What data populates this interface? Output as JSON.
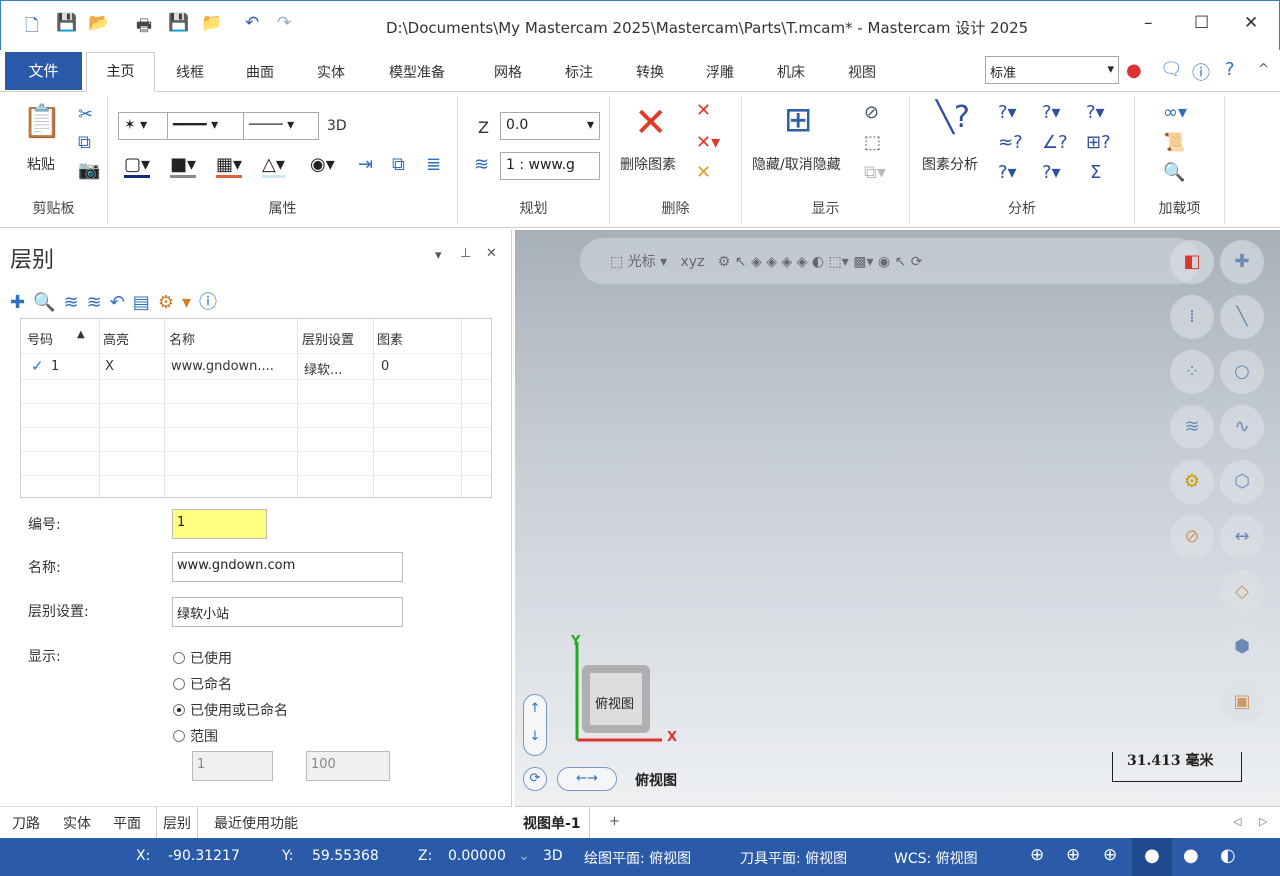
{
  "window": {
    "title": "D:\\Documents\\My Mastercam 2025\\Mastercam\\Parts\\T.mcam* - Mastercam 设计 2025",
    "minimize": "–",
    "maximize": "☐",
    "close": "✕"
  },
  "ribbon_tabs": [
    "文件",
    "主页",
    "线框",
    "曲面",
    "实体",
    "模型准备",
    "网格",
    "标注",
    "转换",
    "浮雕",
    "机床",
    "视图"
  ],
  "style_select": "标准",
  "groups": {
    "clipboard": "剪贴板",
    "paste": "粘贴",
    "attributes": "属性",
    "three_d": "3D",
    "planning": "规划",
    "z_label": "Z",
    "z_value": "0.0",
    "level_value": "1 : www.g",
    "delete": "删除",
    "delete_entity": "删除图素",
    "display": "显示",
    "hide_unhide": "隐藏/取消隐藏",
    "analyze": "分析",
    "entity_analysis": "图素分析",
    "addins": "加载项"
  },
  "panel": {
    "title": "层别",
    "table": {
      "headers": [
        "号码",
        "高亮",
        "名称",
        "层别设置",
        "图素"
      ],
      "rows": [
        {
          "num": "1",
          "highlight": "X",
          "name": "www.gndown....",
          "set": "绿软...",
          "entities": "0"
        }
      ]
    },
    "number_label": "编号:",
    "number_value": "1",
    "name_label": "名称:",
    "name_value": "www.gndown.com",
    "set_label": "层别设置:",
    "set_value": "绿软小站",
    "display_label": "显示:",
    "radios": [
      {
        "label": "已使用",
        "checked": false
      },
      {
        "label": "已命名",
        "checked": false
      },
      {
        "label": "已使用或已命名",
        "checked": true
      },
      {
        "label": "范围",
        "checked": false
      }
    ],
    "range_from": "1",
    "range_to": "100"
  },
  "bottom_tabs": [
    "刀路",
    "实体",
    "平面",
    "层别",
    "最近使用功能"
  ],
  "viewport": {
    "toolbar_cursor": "光标",
    "view_label": "俯视图",
    "cube_label": "俯视图",
    "axis_x": "X",
    "axis_y": "Y",
    "scale": "31.413 毫米",
    "tab": "视图单-1",
    "add_tab": "+"
  },
  "status": {
    "x_label": "X:",
    "x": "-90.31217",
    "y_label": "Y:",
    "y": "59.55368",
    "z_label": "Z:",
    "z": "0.00000",
    "mode": "3D",
    "cplane": "绘图平面: 俯视图",
    "tplane": "刀具平面: 俯视图",
    "wcs": "WCS: 俯视图"
  },
  "colors": {
    "accent": "#2a5aa8",
    "highlight_field": "#ffff80"
  }
}
